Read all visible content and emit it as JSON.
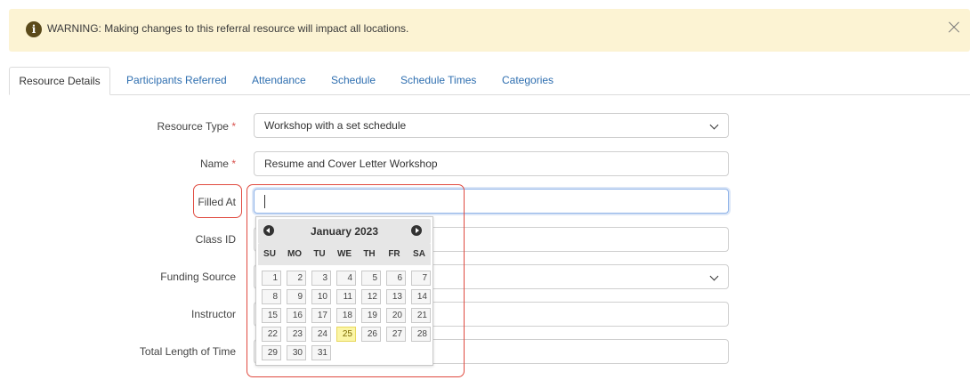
{
  "warning": {
    "icon": "info-icon",
    "icon_glyph": "i",
    "text": "WARNING: Making changes to this referral resource will impact all locations.",
    "close_icon": "close-icon"
  },
  "tabs": [
    {
      "label": "Resource Details",
      "active": true
    },
    {
      "label": "Participants Referred"
    },
    {
      "label": "Attendance"
    },
    {
      "label": "Schedule"
    },
    {
      "label": "Schedule Times"
    },
    {
      "label": "Categories"
    }
  ],
  "form": {
    "resource_type": {
      "label": "Resource Type",
      "required": "*",
      "value": "Workshop with a set schedule"
    },
    "name": {
      "label": "Name",
      "required": "*",
      "value": "Resume and Cover Letter Workshop"
    },
    "filled_at": {
      "label": "Filled At",
      "value": ""
    },
    "class_id": {
      "label": "Class ID",
      "value": ""
    },
    "funding_source": {
      "label": "Funding Source",
      "value": ""
    },
    "instructor": {
      "label": "Instructor",
      "value": ""
    },
    "total_length": {
      "label": "Total Length of Time",
      "value": ""
    }
  },
  "datepicker": {
    "title": "January 2023",
    "days_of_week": [
      "SU",
      "MO",
      "TU",
      "WE",
      "TH",
      "FR",
      "SA"
    ],
    "weeks": [
      [
        "1",
        "2",
        "3",
        "4",
        "5",
        "6",
        "7"
      ],
      [
        "8",
        "9",
        "10",
        "11",
        "12",
        "13",
        "14"
      ],
      [
        "15",
        "16",
        "17",
        "18",
        "19",
        "20",
        "21"
      ],
      [
        "22",
        "23",
        "24",
        "25",
        "26",
        "27",
        "28"
      ],
      [
        "29",
        "30",
        "31"
      ]
    ],
    "today": "25"
  },
  "colors": {
    "warning_bg": "#fcf3d3",
    "link_blue": "#2f6fb0",
    "highlight_red": "#e04a3f",
    "today_bg": "#fbf5a6"
  }
}
